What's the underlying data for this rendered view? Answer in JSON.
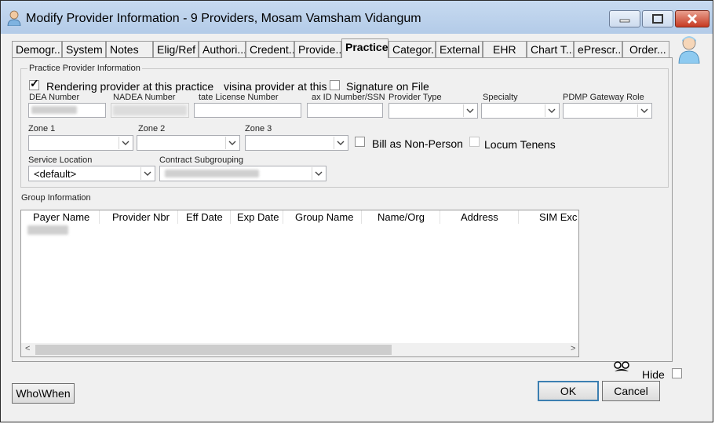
{
  "window": {
    "title": "Modify Provider Information - 9 Providers, Mosam Vamsham Vidangum"
  },
  "tabs": [
    {
      "label": "Demogr...",
      "active": false
    },
    {
      "label": "System",
      "active": false
    },
    {
      "label": "Notes",
      "active": false
    },
    {
      "label": "Elig/Ref",
      "active": false
    },
    {
      "label": "Authori...",
      "active": false
    },
    {
      "label": "Credent...",
      "active": false
    },
    {
      "label": "Provide...",
      "active": false
    },
    {
      "label": "Practice",
      "active": true
    },
    {
      "label": "Categor...",
      "active": false
    },
    {
      "label": "External",
      "active": false
    },
    {
      "label": "EHR",
      "active": false
    },
    {
      "label": "Chart T...",
      "active": false
    },
    {
      "label": "ePrescr...",
      "active": false
    },
    {
      "label": "Order...",
      "active": false
    }
  ],
  "practice": {
    "group_title": "Practice Provider Information",
    "rendering_label": "Rendering provider at this practice",
    "rendering_checked": true,
    "supervising_label": "visina provider at this",
    "signature_label": "Signature on File",
    "dea_label": "DEA Number",
    "nadea_label": "NADEA Number",
    "state_license_label": "tate License Number",
    "tax_id_label": "ax ID Number/SSN",
    "provider_type_label": "Provider Type",
    "specialty_label": "Specialty",
    "pdmp_label": "PDMP Gateway Role",
    "zone1_label": "Zone 1",
    "zone2_label": "Zone 2",
    "zone3_label": "Zone 3",
    "bill_label": "Bill as Non-Person",
    "locum_label": "Locum Tenens",
    "service_location_label": "Service Location",
    "service_location_value": "<default>",
    "contract_label": "Contract Subgrouping"
  },
  "group_info": {
    "title": "Group Information",
    "columns": [
      "Payer Name",
      "Provider Nbr",
      "Eff Date",
      "Exp Date",
      "Group Name",
      "Name/Org",
      "Address",
      "SIM Exc"
    ]
  },
  "footer": {
    "who_when": "Who\\When",
    "hide_label": "Hide",
    "ok": "OK",
    "cancel": "Cancel"
  }
}
